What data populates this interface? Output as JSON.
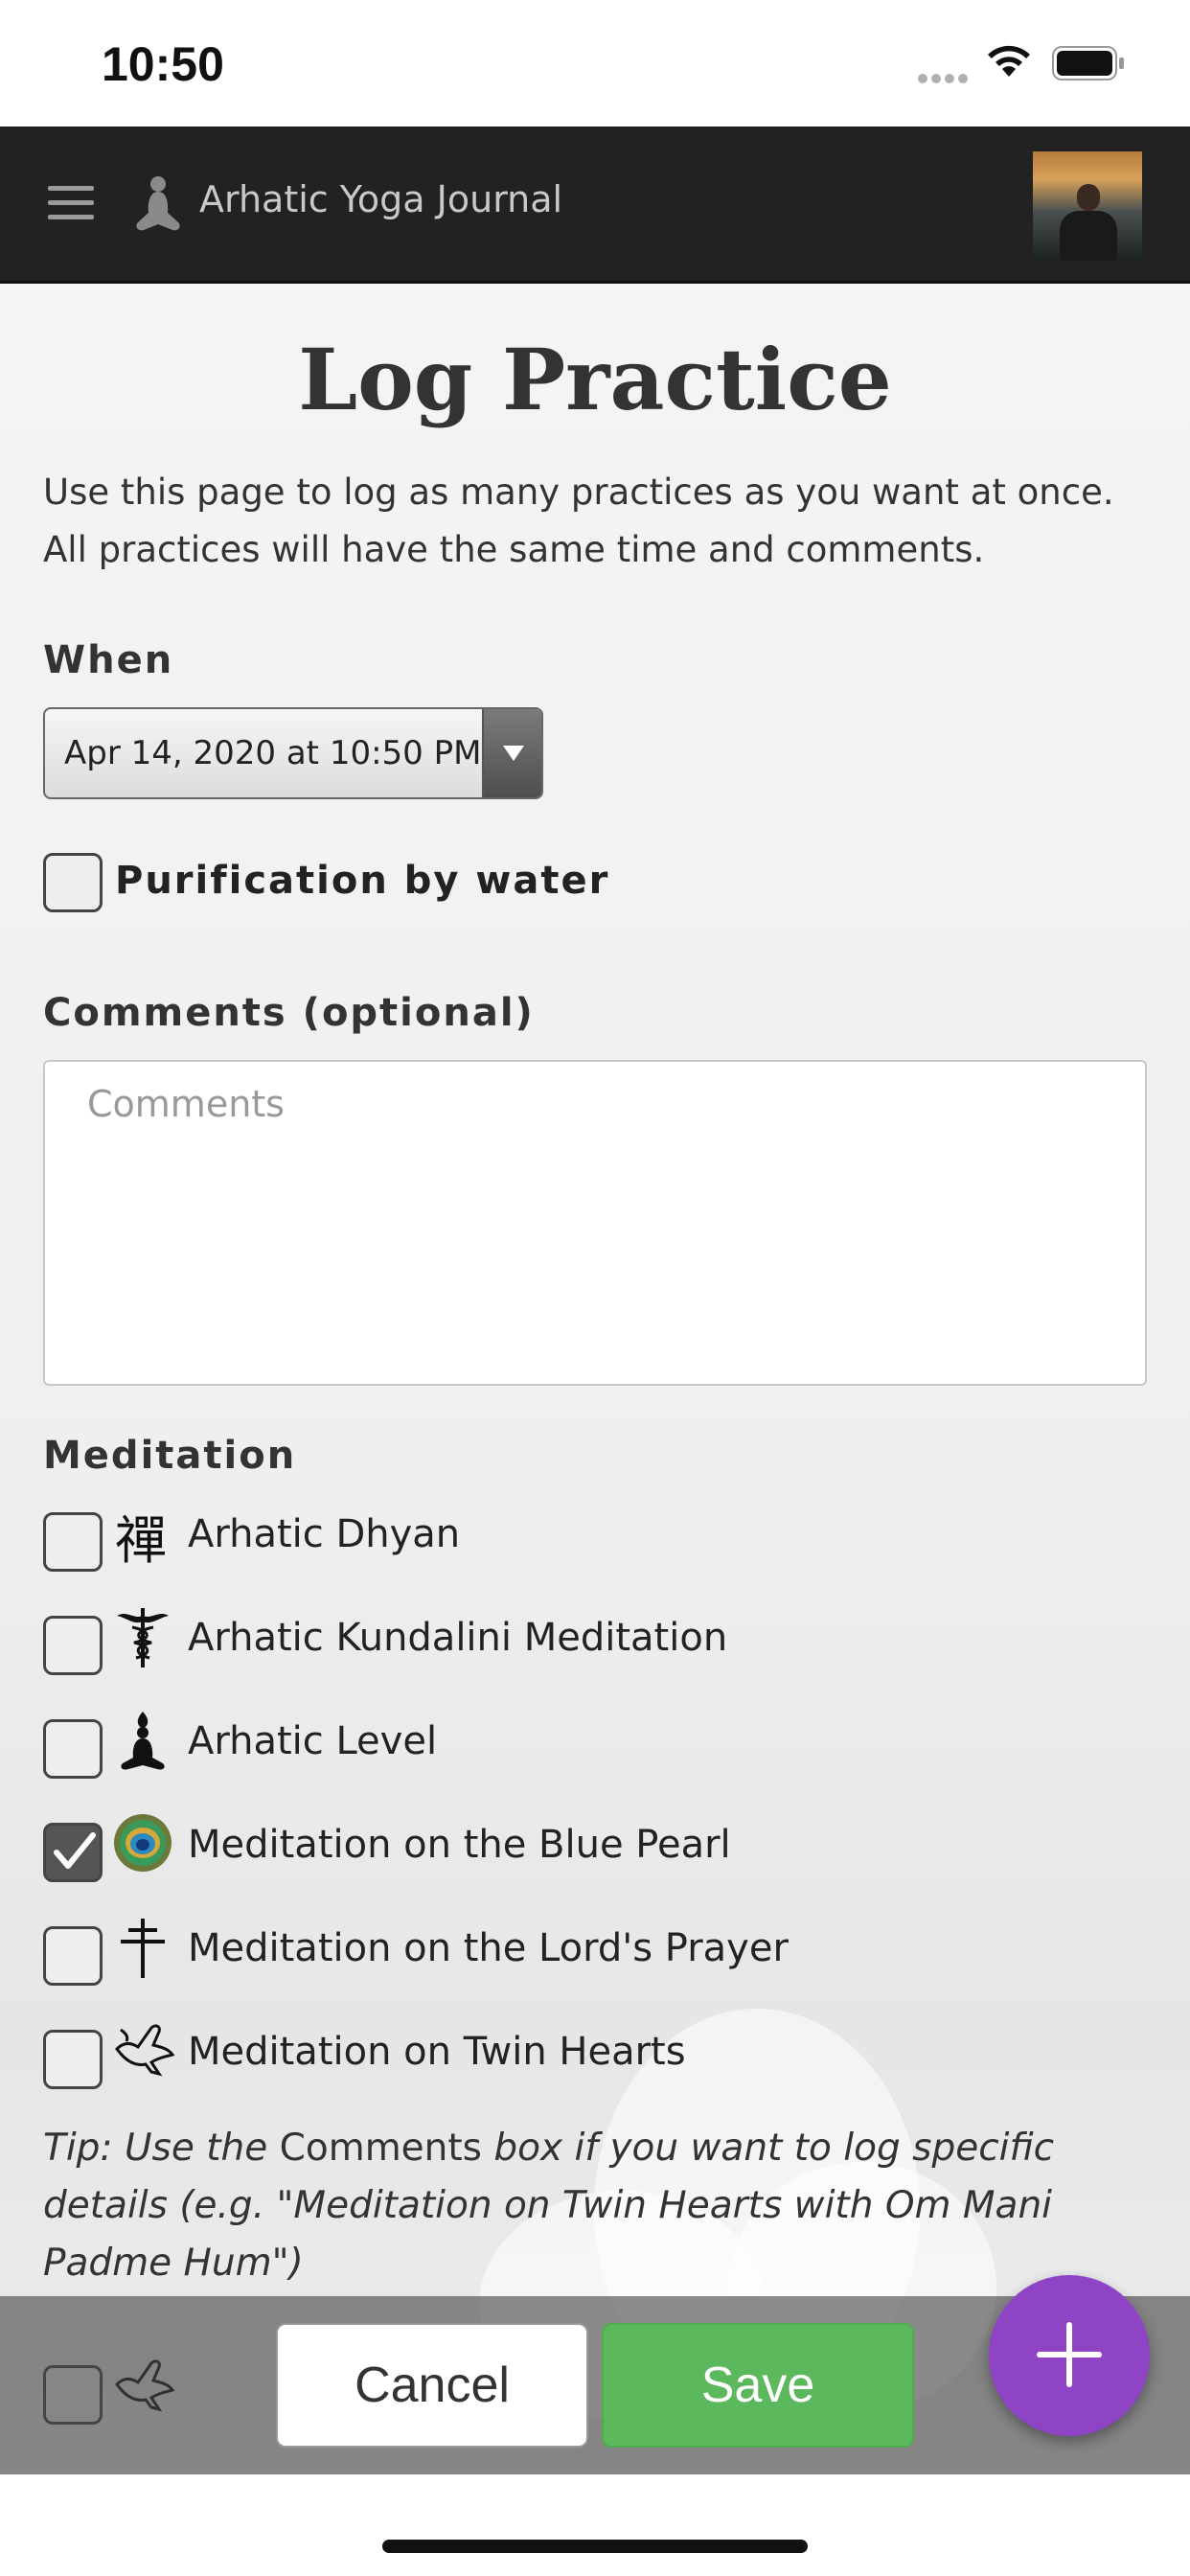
{
  "status_bar": {
    "time": "10:50"
  },
  "nav": {
    "title": "Arhatic Yoga Journal"
  },
  "page": {
    "title": "Log Practice",
    "description": "Use this page to log as many practices as you want at once. All practices will have the same time and comments."
  },
  "when": {
    "label": "When",
    "value": "Apr 14, 2020 at 10:50 PM"
  },
  "purification": {
    "label": "Purification by water",
    "checked": false
  },
  "comments": {
    "label": "Comments (optional)",
    "placeholder": "Comments",
    "value": ""
  },
  "meditation": {
    "label": "Meditation",
    "items": [
      {
        "label": "Arhatic Dhyan",
        "icon": "zen-character-icon",
        "checked": false
      },
      {
        "label": "Arhatic Kundalini Meditation",
        "icon": "caduceus-icon",
        "checked": false
      },
      {
        "label": "Arhatic Level",
        "icon": "meditating-figure-icon",
        "checked": false
      },
      {
        "label": "Meditation on the Blue Pearl",
        "icon": "peacock-feather-icon",
        "checked": true
      },
      {
        "label": "Meditation on the Lord's Prayer",
        "icon": "cross-icon",
        "checked": false
      },
      {
        "label": "Meditation on Twin Hearts",
        "icon": "dove-icon",
        "checked": false
      }
    ]
  },
  "tip": {
    "prefix": "Tip: Use the ",
    "highlight": "Comments",
    "suffix": " box if you want to log specific details (e.g. \"Meditation on Twin Hearts with Om Mani Padme Hum\")"
  },
  "footer": {
    "cancel_label": "Cancel",
    "save_label": "Save"
  },
  "colors": {
    "nav_background": "#222222",
    "save_button": "#5cb85c",
    "fab": "#8e44c4"
  }
}
